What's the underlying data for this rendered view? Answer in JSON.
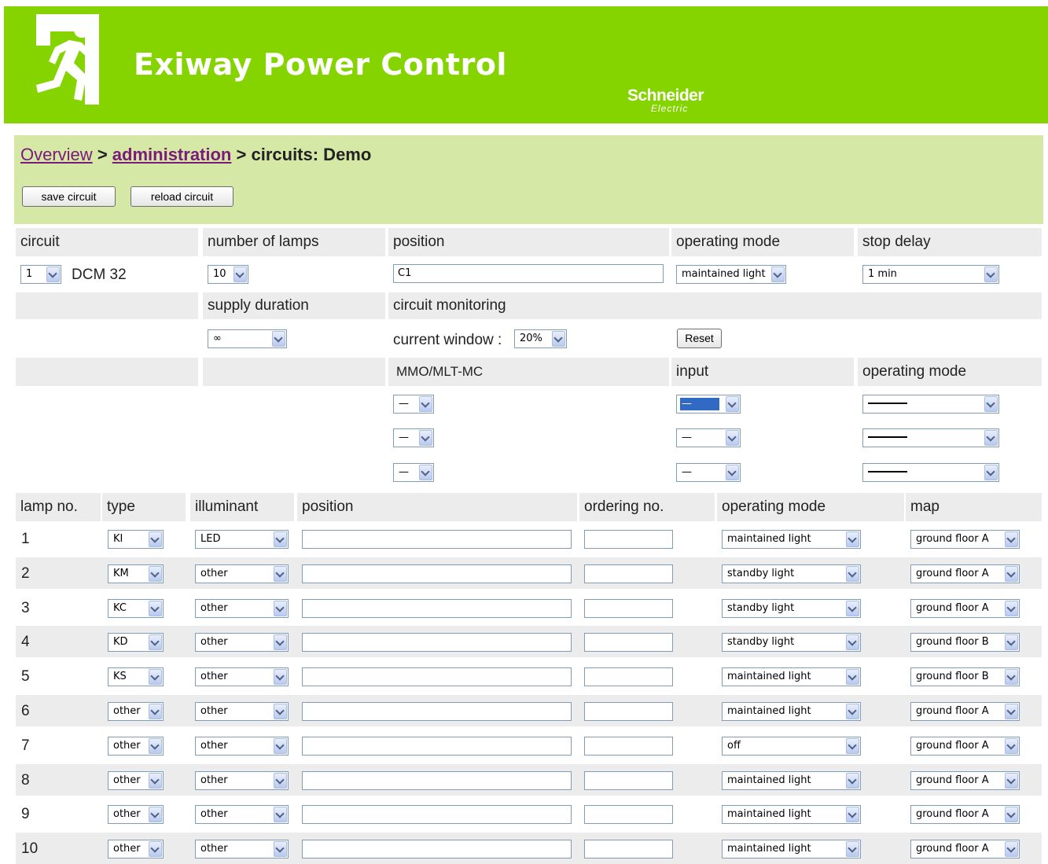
{
  "header": {
    "title": "Exiway Power Control",
    "brand_line1": "Schneider",
    "brand_line2": "Electric"
  },
  "breadcrumb": {
    "overview": "Overview",
    "administration": "administration",
    "sep": ">",
    "current": "circuits: Demo"
  },
  "buttons": {
    "save": "save circuit",
    "reload": "reload circuit",
    "reset": "Reset"
  },
  "circuit_headers": {
    "circuit": "circuit",
    "number_of_lamps": "number of lamps",
    "position": "position",
    "operating_mode": "operating mode",
    "stop_delay": "stop delay"
  },
  "circuit": {
    "number": "1",
    "device": "DCM 32",
    "lamps": "10",
    "position": "C1",
    "operating_mode": "maintained light",
    "stop_delay": "1 min"
  },
  "supply": {
    "supply_duration_label": "supply duration",
    "circuit_monitoring_label": "circuit monitoring",
    "supply_duration": "∞",
    "current_window_label": "current window :",
    "current_window": "20%"
  },
  "inputs_headers": {
    "mmo": "MMO/MLT-MC",
    "input": "input",
    "operating_mode": "operating mode"
  },
  "inputs_rows": [
    {
      "mmo": "—",
      "input": "—",
      "mode": ""
    },
    {
      "mmo": "—",
      "input": "—",
      "mode": ""
    },
    {
      "mmo": "—",
      "input": "—",
      "mode": ""
    }
  ],
  "lamps_headers": {
    "lamp_no": "lamp no.",
    "type": "type",
    "illuminant": "illuminant",
    "position": "position",
    "ordering_no": "ordering no.",
    "operating_mode": "operating mode",
    "map": "map"
  },
  "lamps": [
    {
      "no": "1",
      "type": "KI",
      "illuminant": "LED",
      "position": "",
      "ordering": "",
      "mode": "maintained light",
      "map": "ground floor A"
    },
    {
      "no": "2",
      "type": "KM",
      "illuminant": "other",
      "position": "",
      "ordering": "",
      "mode": "standby light",
      "map": "ground floor A"
    },
    {
      "no": "3",
      "type": "KC",
      "illuminant": "other",
      "position": "",
      "ordering": "",
      "mode": "standby light",
      "map": "ground floor A"
    },
    {
      "no": "4",
      "type": "KD",
      "illuminant": "other",
      "position": "",
      "ordering": "",
      "mode": "standby light",
      "map": "ground floor B"
    },
    {
      "no": "5",
      "type": "KS",
      "illuminant": "other",
      "position": "",
      "ordering": "",
      "mode": "maintained light",
      "map": "ground floor B"
    },
    {
      "no": "6",
      "type": "other",
      "illuminant": "other",
      "position": "",
      "ordering": "",
      "mode": "maintained light",
      "map": "ground floor A"
    },
    {
      "no": "7",
      "type": "other",
      "illuminant": "other",
      "position": "",
      "ordering": "",
      "mode": "off",
      "map": "ground floor A"
    },
    {
      "no": "8",
      "type": "other",
      "illuminant": "other",
      "position": "",
      "ordering": "",
      "mode": "maintained light",
      "map": "ground floor A"
    },
    {
      "no": "9",
      "type": "other",
      "illuminant": "other",
      "position": "",
      "ordering": "",
      "mode": "maintained light",
      "map": "ground floor A"
    },
    {
      "no": "10",
      "type": "other",
      "illuminant": "other",
      "position": "",
      "ordering": "",
      "mode": "maintained light",
      "map": "ground floor A"
    }
  ],
  "colors": {
    "header_green": "#85d400",
    "toolbar_green": "#d6e8a6",
    "link_purple": "#7a1a7a"
  }
}
